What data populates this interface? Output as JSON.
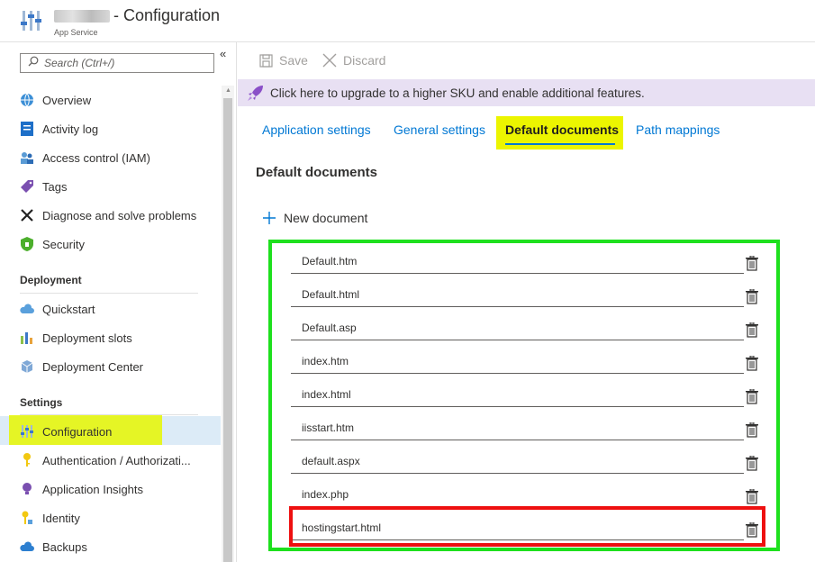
{
  "header": {
    "title": "- Configuration",
    "subtitle": "App Service"
  },
  "sidebar": {
    "search_placeholder": "Search (Ctrl+/)",
    "collapse_glyph": "«",
    "items_top": [
      {
        "label": "Overview",
        "icon": "globe-icon"
      },
      {
        "label": "Activity log",
        "icon": "activity-log-icon"
      },
      {
        "label": "Access control (IAM)",
        "icon": "people-icon"
      },
      {
        "label": "Tags",
        "icon": "tag-icon"
      },
      {
        "label": "Diagnose and solve problems",
        "icon": "wrench-icon"
      },
      {
        "label": "Security",
        "icon": "shield-icon"
      }
    ],
    "section_deployment": "Deployment",
    "items_deployment": [
      {
        "label": "Quickstart",
        "icon": "cloud-icon"
      },
      {
        "label": "Deployment slots",
        "icon": "slots-icon"
      },
      {
        "label": "Deployment Center",
        "icon": "cube-icon"
      }
    ],
    "section_settings": "Settings",
    "items_settings": [
      {
        "label": "Configuration",
        "icon": "sliders-icon"
      },
      {
        "label": "Authentication / Authorizati...",
        "icon": "key-icon"
      },
      {
        "label": "Application Insights",
        "icon": "lightbulb-icon"
      },
      {
        "label": "Identity",
        "icon": "identity-key-icon"
      },
      {
        "label": "Backups",
        "icon": "backup-cloud-icon"
      }
    ]
  },
  "toolbar": {
    "save_label": "Save",
    "discard_label": "Discard"
  },
  "banner": {
    "text": "Click here to upgrade to a higher SKU and enable additional features."
  },
  "tabs": [
    {
      "label": "Application settings"
    },
    {
      "label": "General settings"
    },
    {
      "label": "Default documents"
    },
    {
      "label": "Path mappings"
    }
  ],
  "main": {
    "section_title": "Default documents",
    "new_document_label": "New document",
    "documents": [
      "Default.htm",
      "Default.html",
      "Default.asp",
      "index.htm",
      "index.html",
      "iisstart.htm",
      "default.aspx",
      "index.php",
      "hostingstart.html"
    ]
  },
  "colors": {
    "accent": "#0078d4",
    "banner_bg": "#e8e0f3",
    "highlight_yellow": "#e6f700",
    "green_box": "#1ee01e",
    "red_box": "#ee1010"
  }
}
